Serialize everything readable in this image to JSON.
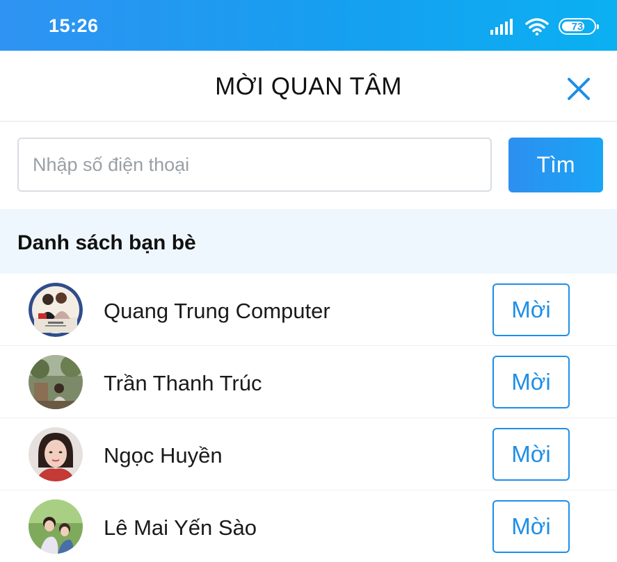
{
  "status_bar": {
    "time": "15:26",
    "battery_level": "73",
    "icons": [
      "signal-icon",
      "wifi-icon",
      "battery-icon"
    ]
  },
  "header": {
    "title": "MỜI QUAN TÂM",
    "close_icon": "close-icon"
  },
  "search": {
    "placeholder": "Nhập số điện thoại",
    "value": "",
    "button_label": "Tìm"
  },
  "friends_section": {
    "title": "Danh sách bạn bè",
    "friends": [
      {
        "name": "Quang Trung Computer",
        "invite_label": "Mời"
      },
      {
        "name": "Trần Thanh Trúc",
        "invite_label": "Mời"
      },
      {
        "name": "Ngọc Huyền",
        "invite_label": "Mời"
      },
      {
        "name": "Lê Mai Yến Sào",
        "invite_label": "Mời"
      }
    ]
  },
  "colors": {
    "accent": "#1e8ee6",
    "status_bar_start": "#2f93f2",
    "status_bar_end": "#0bb0f2",
    "section_background": "#eef7fe"
  }
}
